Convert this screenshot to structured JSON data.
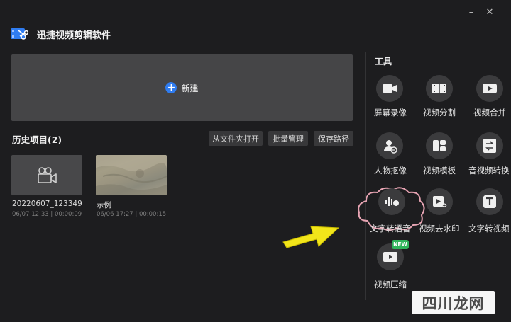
{
  "app": {
    "title": "迅捷视频剪辑软件"
  },
  "window": {
    "minimize": "–",
    "close": "✕"
  },
  "new_project": {
    "label": "新建"
  },
  "history": {
    "title": "历史项目(2)",
    "buttons": [
      "从文件夹打开",
      "批量管理",
      "保存路径"
    ],
    "projects": [
      {
        "name": "20220607_123349",
        "meta": "06/07 12:33 | 00:00:09"
      },
      {
        "name": "示例",
        "meta": "06/06 17:27 | 00:00:15"
      }
    ]
  },
  "tools": {
    "title": "工具",
    "items": [
      {
        "label": "屏幕录像",
        "icon": "screen-record-icon"
      },
      {
        "label": "视频分割",
        "icon": "video-split-icon"
      },
      {
        "label": "视频合并",
        "icon": "video-merge-icon"
      },
      {
        "label": "人物抠像",
        "icon": "portrait-cutout-icon"
      },
      {
        "label": "视频模板",
        "icon": "video-template-icon"
      },
      {
        "label": "音视频转换",
        "icon": "av-convert-icon"
      },
      {
        "label": "文字转语音",
        "icon": "text-to-speech-icon"
      },
      {
        "label": "视频去水印",
        "icon": "remove-watermark-icon"
      },
      {
        "label": "文字转视频",
        "icon": "text-to-video-icon"
      },
      {
        "label": "视频压缩",
        "icon": "video-compress-icon",
        "badge": "NEW"
      }
    ]
  },
  "watermark": {
    "text": "四川龙网"
  },
  "colors": {
    "accent": "#2f7cf0",
    "background": "#1d1d1f",
    "panel": "#454547",
    "badge": "#2fb45a",
    "arrow": "#f2e51a"
  }
}
